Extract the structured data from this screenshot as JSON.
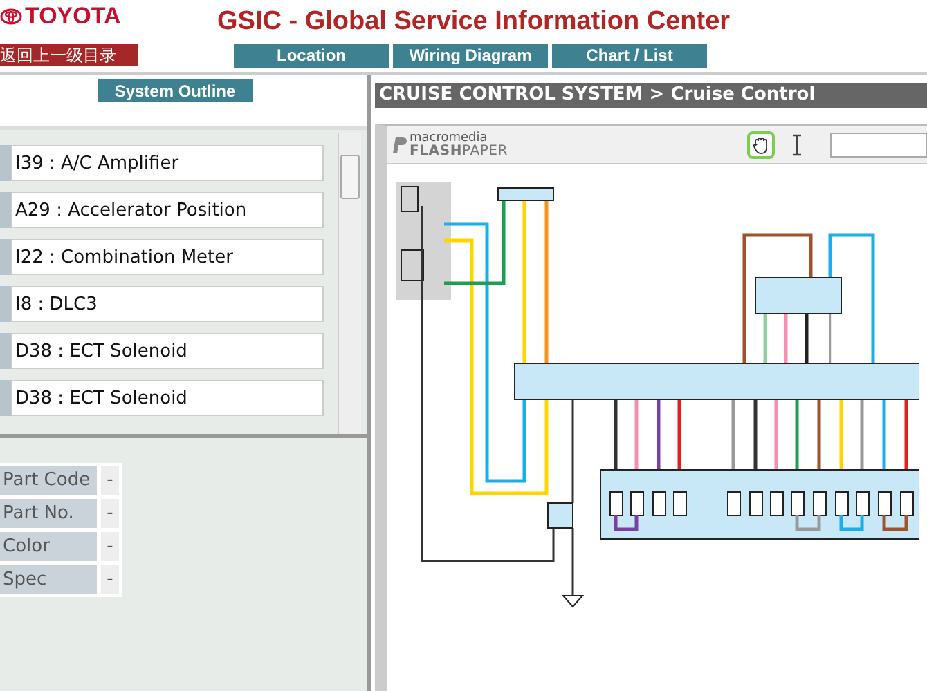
{
  "header": {
    "brand": "TOYOTA",
    "title": "GSIC - Global Service Information Center",
    "back_button": "返回上一级目录",
    "tabs": [
      {
        "label": "Location"
      },
      {
        "label": "Wiring Diagram"
      },
      {
        "label": "Chart / List"
      }
    ]
  },
  "left_panel": {
    "outline_button": "System Outline",
    "parts": [
      "I39 : A/C Amplifier",
      "A29 : Accelerator Position",
      "I22 : Combination Meter",
      "I8 : DLC3",
      "D38 : ECT Solenoid",
      "D38 : ECT Solenoid"
    ],
    "details": [
      {
        "label": "Part Code",
        "value": "-"
      },
      {
        "label": "Part No.",
        "value": "-"
      },
      {
        "label": "Color",
        "value": "-"
      },
      {
        "label": "Spec",
        "value": "-"
      }
    ]
  },
  "viewer": {
    "breadcrumb": "CRUISE CONTROL SYSTEM > Cruise Control",
    "logo_top": "macromedia",
    "logo_bottom": "**FLASH**PAPER",
    "tools": [
      {
        "kind": "hand",
        "selected": true
      },
      {
        "kind": "text-select",
        "selected": false
      }
    ]
  }
}
